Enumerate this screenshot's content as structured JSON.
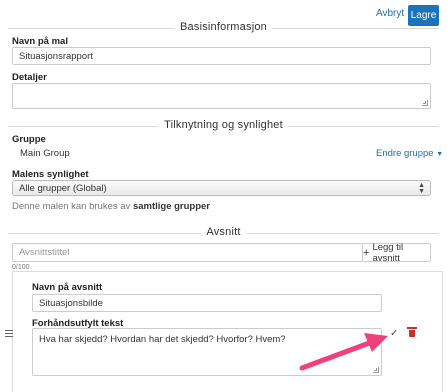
{
  "toolbar": {
    "cancel_label": "Avbryt",
    "save_label": "Lagre"
  },
  "basic": {
    "section_title": "Basisinformasjon",
    "name_label": "Navn på mal",
    "name_value": "Situasjonsrapport",
    "details_label": "Detaljer",
    "details_value": ""
  },
  "visibility": {
    "section_title": "Tilknytning og synlighet",
    "group_label": "Gruppe",
    "group_value": "Main Group",
    "change_group_label": "Endre gruppe",
    "scope_label": "Malens synlighet",
    "scope_value": "Alle grupper (Global)",
    "help_prefix": "Denne malen kan brukes av ",
    "help_bold": "samtlige grupper"
  },
  "sections": {
    "section_title": "Avsnitt",
    "title_placeholder": "Avsnittstittel",
    "add_label": "Legg til avsnitt",
    "counter": "0/100",
    "item": {
      "name_label": "Navn på avsnitt",
      "name_value": "Situasjonsbilde",
      "prefill_label": "Forhåndsutfylt tekst",
      "prefill_value": "Hva har skjedd? Hvordan har det skjedd? Hvorfor? Hvem?"
    }
  },
  "icons": {
    "drag": "drag-handle-icon",
    "confirm": "checkmark-icon",
    "delete": "trash-icon",
    "caret": "caret-down-icon",
    "plus": "plus-icon",
    "annotation": "pink-arrow"
  },
  "colors": {
    "accent": "#1d73b8",
    "link": "#1e6fb0",
    "danger": "#c9302c",
    "annotation": "#f0407a"
  }
}
